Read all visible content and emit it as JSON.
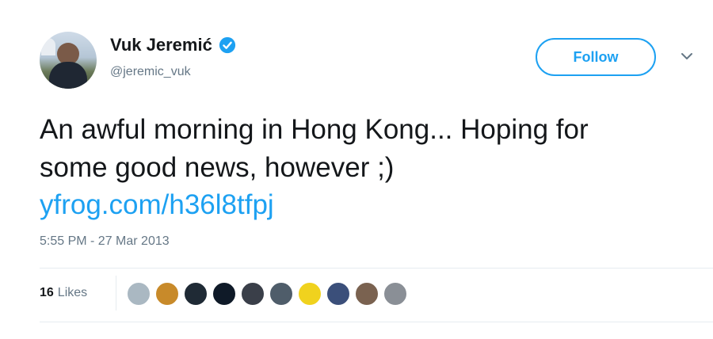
{
  "tweet": {
    "author": {
      "display_name": "Vuk Jeremić",
      "handle": "@jeremic_vuk",
      "verified": true
    },
    "follow_label": "Follow",
    "text_lines": [
      "An awful morning in Hong Kong... Hoping for",
      "some good news, however ;)"
    ],
    "link": "yfrog.com/h36l8tfpj",
    "timestamp": "5:55 PM - 27 Mar 2013",
    "likes": {
      "count": "16",
      "label": "Likes"
    },
    "liker_avatars": [
      {
        "icon": "default-avatar-icon",
        "color": "#aab8c2"
      },
      {
        "icon": "mascot-avatar-icon",
        "color": "#c88a2a"
      },
      {
        "icon": "avatar",
        "color": "#1f2a35"
      },
      {
        "icon": "avatar",
        "color": "#0f1a28"
      },
      {
        "icon": "avatar",
        "color": "#3a3f49"
      },
      {
        "icon": "avatar",
        "color": "#4f5d6a"
      },
      {
        "icon": "avatar",
        "color": "#f0d21e"
      },
      {
        "icon": "avatar",
        "color": "#3b4f7a"
      },
      {
        "icon": "avatar",
        "color": "#7a6250"
      },
      {
        "icon": "avatar",
        "color": "#8a8f96"
      }
    ]
  },
  "colors": {
    "accent": "#1da1f2",
    "text": "#14171a",
    "muted": "#657786"
  }
}
